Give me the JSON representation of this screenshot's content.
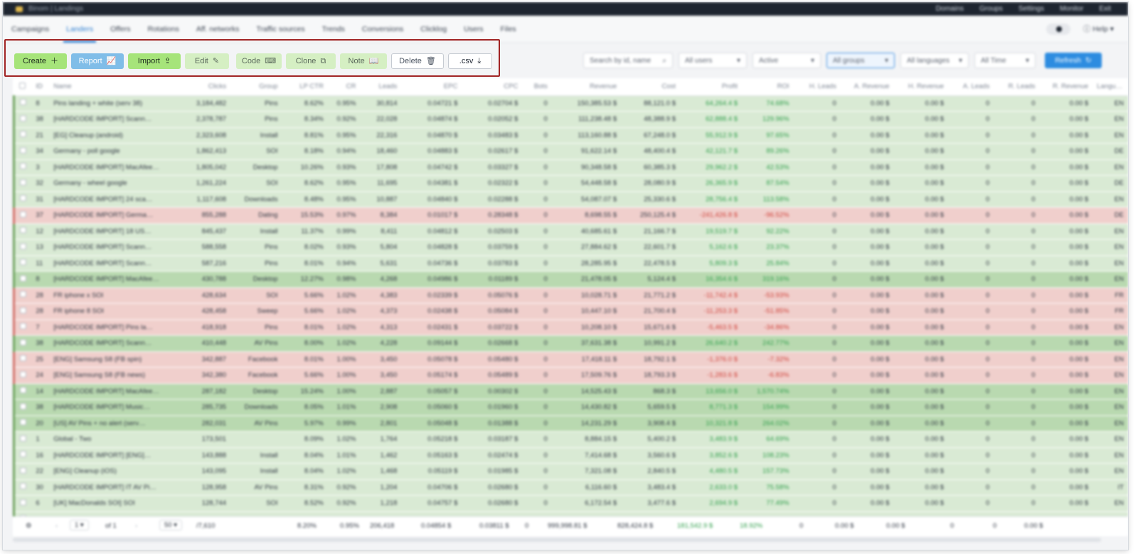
{
  "topbar": {
    "app_title": "Binom | Landings",
    "links": [
      "Domains",
      "Groups",
      "Settings",
      "Monitor",
      "Exit"
    ]
  },
  "nav": {
    "items": [
      "Campaigns",
      "Landers",
      "Offers",
      "Rotations",
      "Aff. networks",
      "Traffic sources",
      "Trends",
      "Conversions",
      "Clicklog",
      "Users",
      "Files"
    ],
    "active": "Landers",
    "help_label": "Help"
  },
  "toolbar": {
    "create": "Create",
    "report": "Report",
    "import": "Import",
    "edit": "Edit",
    "code": "Code",
    "clone": "Clone",
    "note": "Note",
    "delete": "Delete",
    "csv": ".csv",
    "search_placeholder": "Search by id, name",
    "users_filter": "All users",
    "status_filter": "Active",
    "groups_filter": "All groups",
    "languages_filter": "All languages",
    "time_filter": "All Time",
    "refresh": "Refresh"
  },
  "table": {
    "headers": [
      "ID",
      "Name",
      "Clicks",
      "Group",
      "LP CTR",
      "CR",
      "Leads",
      "EPC",
      "CPC",
      "Bots",
      "Revenue",
      "Cost",
      "Profit",
      "ROI",
      "H. Leads",
      "A. Revenue",
      "H. Revenue",
      "A. Leads",
      "R. Leads",
      "R. Revenue",
      "Language"
    ],
    "rows": [
      {
        "tone": "good",
        "id": "8",
        "name": "Pins landing + white (serv 38)",
        "clicks": "3,184,482",
        "group": "Pins",
        "lpctr": "8.62%",
        "cr": "0.95%",
        "leads": "30,814",
        "epc": "0.04721 $",
        "cpc": "0.02704 $",
        "bots": "0",
        "revenue": "150,385.53 $",
        "cost": "88,121.0 $",
        "profit": "64,264.4 $",
        "roi": "74.68%",
        "lang": "EN"
      },
      {
        "tone": "good",
        "id": "38",
        "name": "[HARDCODE IMPORT] Scann…",
        "clicks": "2,378,787",
        "group": "Pins",
        "lpctr": "8.34%",
        "cr": "0.92%",
        "leads": "22,028",
        "epc": "0.04874 $",
        "cpc": "0.02052 $",
        "bots": "0",
        "revenue": "111,238.48 $",
        "cost": "48,388.9 $",
        "profit": "62,888.4 $",
        "roi": "129.96%",
        "lang": "EN"
      },
      {
        "tone": "good",
        "id": "21",
        "name": "[EG] Cleanup (android)",
        "clicks": "2,323,608",
        "group": "Install",
        "lpctr": "8.81%",
        "cr": "0.95%",
        "leads": "22,316",
        "epc": "0.04870 $",
        "cpc": "0.03483 $",
        "bots": "0",
        "revenue": "113,160.88 $",
        "cost": "67,248.0 $",
        "profit": "55,912.9 $",
        "roi": "97.65%",
        "lang": "EN"
      },
      {
        "tone": "good",
        "id": "34",
        "name": "Germany - poll google",
        "clicks": "1,862,413",
        "group": "SOI",
        "lpctr": "8.18%",
        "cr": "0.94%",
        "leads": "18,460",
        "epc": "0.04883 $",
        "cpc": "0.02617 $",
        "bots": "0",
        "revenue": "91,622.14 $",
        "cost": "48,400.4 $",
        "profit": "42,121.7 $",
        "roi": "89.26%",
        "lang": "DE"
      },
      {
        "tone": "good",
        "id": "3",
        "name": "[HARDCODE IMPORT] MacAfee…",
        "clicks": "1,805,042",
        "group": "Desktop",
        "lpctr": "10.26%",
        "cr": "0.93%",
        "leads": "17,808",
        "epc": "0.04742 $",
        "cpc": "0.03327 $",
        "bots": "0",
        "revenue": "90,348.58 $",
        "cost": "60,385.3 $",
        "profit": "29,962.2 $",
        "roi": "42.53%",
        "lang": "EN"
      },
      {
        "tone": "good",
        "id": "32",
        "name": "Germany - wheel google",
        "clicks": "1,261,224",
        "group": "SOI",
        "lpctr": "8.62%",
        "cr": "0.95%",
        "leads": "11,695",
        "epc": "0.04381 $",
        "cpc": "0.02322 $",
        "bots": "0",
        "revenue": "54,448.58 $",
        "cost": "28,080.9 $",
        "profit": "26,365.9 $",
        "roi": "87.54%",
        "lang": "DE"
      },
      {
        "tone": "good",
        "id": "31",
        "name": "[HARDCODE IMPORT] 24 sca…",
        "clicks": "1,117,608",
        "group": "Downloads",
        "lpctr": "8.48%",
        "cr": "0.95%",
        "leads": "10,887",
        "epc": "0.04840 $",
        "cpc": "0.02288 $",
        "bots": "0",
        "revenue": "54,087.07 $",
        "cost": "25,330.6 $",
        "profit": "28,756.4 $",
        "roi": "113.58%",
        "lang": "EN"
      },
      {
        "tone": "bad",
        "id": "37",
        "name": "[HARDCODE IMPORT] Germa…",
        "clicks": "855,288",
        "group": "Dating",
        "lpctr": "15.53%",
        "cr": "0.97%",
        "leads": "8,384",
        "epc": "0.01017 $",
        "cpc": "0.28348 $",
        "bots": "0",
        "revenue": "8,698.55 $",
        "cost": "250,125.4 $",
        "profit": "-241,426.8 $",
        "roi": "-96.52%",
        "lang": "DE"
      },
      {
        "tone": "good",
        "id": "12",
        "name": "[HARDCODE IMPORT] 18 US…",
        "clicks": "845,437",
        "group": "Install",
        "lpctr": "11.37%",
        "cr": "0.99%",
        "leads": "8,411",
        "epc": "0.04812 $",
        "cpc": "0.02503 $",
        "bots": "0",
        "revenue": "40,685.61 $",
        "cost": "21,166.7 $",
        "profit": "19,519.7 $",
        "roi": "92.22%",
        "lang": "EN"
      },
      {
        "tone": "good",
        "id": "13",
        "name": "[HARDCODE IMPORT] Scann…",
        "clicks": "588,558",
        "group": "Pins",
        "lpctr": "8.02%",
        "cr": "0.93%",
        "leads": "5,804",
        "epc": "0.04828 $",
        "cpc": "0.03759 $",
        "bots": "0",
        "revenue": "27,884.62 $",
        "cost": "22,601.7 $",
        "profit": "5,162.6 $",
        "roi": "23.37%",
        "lang": "EN"
      },
      {
        "tone": "good",
        "id": "11",
        "name": "[HARDCODE IMPORT] Scann…",
        "clicks": "587,216",
        "group": "Pins",
        "lpctr": "8.01%",
        "cr": "0.94%",
        "leads": "5,631",
        "epc": "0.04736 $",
        "cpc": "0.03783 $",
        "bots": "0",
        "revenue": "28,285.95 $",
        "cost": "22,478.5 $",
        "profit": "5,809.3 $",
        "roi": "25.84%",
        "lang": "EN"
      },
      {
        "tone": "strong",
        "id": "8",
        "name": "[HARDCODE IMPORT] MacAfee…",
        "clicks": "430,788",
        "group": "Desktop",
        "lpctr": "12.27%",
        "cr": "0.98%",
        "leads": "4,268",
        "epc": "0.04986 $",
        "cpc": "0.01189 $",
        "bots": "0",
        "revenue": "21,478.05 $",
        "cost": "5,124.4 $",
        "profit": "16,354.6 $",
        "roi": "319.16%",
        "lang": "EN"
      },
      {
        "tone": "bad",
        "id": "28",
        "name": "FR iphone x SOI",
        "clicks": "428,634",
        "group": "SOI",
        "lpctr": "5.66%",
        "cr": "1.02%",
        "leads": "4,383",
        "epc": "0.02339 $",
        "cpc": "0.05076 $",
        "bots": "0",
        "revenue": "10,028.71 $",
        "cost": "21,771.2 $",
        "profit": "-11,742.4 $",
        "roi": "-53.93%",
        "lang": "FR"
      },
      {
        "tone": "bad",
        "id": "28",
        "name": "FR iphone 8 SOI",
        "clicks": "428,458",
        "group": "Sweep",
        "lpctr": "5.66%",
        "cr": "1.02%",
        "leads": "4,373",
        "epc": "0.02438 $",
        "cpc": "0.05084 $",
        "bots": "0",
        "revenue": "10,447.10 $",
        "cost": "21,700.4 $",
        "profit": "-11,253.3 $",
        "roi": "-51.85%",
        "lang": "FR"
      },
      {
        "tone": "bad",
        "id": "7",
        "name": "[HARDCODE IMPORT] Pins la…",
        "clicks": "418,918",
        "group": "Pins",
        "lpctr": "8.01%",
        "cr": "1.02%",
        "leads": "4,313",
        "epc": "0.02431 $",
        "cpc": "0.03722 $",
        "bots": "0",
        "revenue": "10,208.10 $",
        "cost": "15,671.6 $",
        "profit": "-5,463.5 $",
        "roi": "-34.86%",
        "lang": "EN"
      },
      {
        "tone": "strong",
        "id": "38",
        "name": "[HARDCODE IMPORT] Scann…",
        "clicks": "410,448",
        "group": "AV Pins",
        "lpctr": "8.00%",
        "cr": "1.02%",
        "leads": "4,228",
        "epc": "0.09144 $",
        "cpc": "0.02668 $",
        "bots": "0",
        "revenue": "37,631.38 $",
        "cost": "10,991.2 $",
        "profit": "26,640.2 $",
        "roi": "242.77%",
        "lang": "EN"
      },
      {
        "tone": "bad",
        "id": "25",
        "name": "[ENG] Samsung S8 (FB spin)",
        "clicks": "342,887",
        "group": "Facebook",
        "lpctr": "8.01%",
        "cr": "1.00%",
        "leads": "3,450",
        "epc": "0.05078 $",
        "cpc": "0.05480 $",
        "bots": "0",
        "revenue": "17,418.11 $",
        "cost": "18,792.1 $",
        "profit": "-1,376.0 $",
        "roi": "-7.32%",
        "lang": "EN"
      },
      {
        "tone": "bad",
        "id": "24",
        "name": "[ENG] Samsung S8 (FB news)",
        "clicks": "342,380",
        "group": "Facebook",
        "lpctr": "5.66%",
        "cr": "1.00%",
        "leads": "3,450",
        "epc": "0.05174 $",
        "cpc": "0.05489 $",
        "bots": "0",
        "revenue": "17,509.76 $",
        "cost": "18,793.3 $",
        "profit": "-1,283.6 $",
        "roi": "-6.83%",
        "lang": "EN"
      },
      {
        "tone": "strong",
        "id": "14",
        "name": "[HARDCODE IMPORT] MacAfee…",
        "clicks": "287,182",
        "group": "Desktop",
        "lpctr": "15.24%",
        "cr": "1.00%",
        "leads": "2,887",
        "epc": "0.05057 $",
        "cpc": "0.00302 $",
        "bots": "0",
        "revenue": "14,525.43 $",
        "cost": "868.3 $",
        "profit": "13,656.0 $",
        "roi": "1,570.74%",
        "lang": "EN"
      },
      {
        "tone": "strong",
        "id": "38",
        "name": "[HARDCODE IMPORT] Music…",
        "clicks": "285,735",
        "group": "Downloads",
        "lpctr": "8.05%",
        "cr": "1.01%",
        "leads": "2,908",
        "epc": "0.05060 $",
        "cpc": "0.01960 $",
        "bots": "0",
        "revenue": "14,430.82 $",
        "cost": "5,659.5 $",
        "profit": "8,771.3 $",
        "roi": "154.99%",
        "lang": "EN"
      },
      {
        "tone": "strong",
        "id": "20",
        "name": "[US] AV Pins + no alert (serv…",
        "clicks": "282,031",
        "group": "AV Pins",
        "lpctr": "5.97%",
        "cr": "0.99%",
        "leads": "2,801",
        "epc": "0.05048 $",
        "cpc": "0.01388 $",
        "bots": "0",
        "revenue": "14,231.29 $",
        "cost": "3,908.4 $",
        "profit": "10,321.8 $",
        "roi": "264.02%",
        "lang": "EN"
      },
      {
        "tone": "good",
        "id": "1",
        "name": "Global - Two",
        "clicks": "173,501",
        "group": "",
        "lpctr": "8.09%",
        "cr": "1.02%",
        "leads": "1,764",
        "epc": "0.05218 $",
        "cpc": "0.03187 $",
        "bots": "0",
        "revenue": "8,884.15 $",
        "cost": "5,400.2 $",
        "profit": "3,483.9 $",
        "roi": "64.69%",
        "lang": "EN"
      },
      {
        "tone": "good",
        "id": "16",
        "name": "[HARDCODE IMPORT] [ENG]…",
        "clicks": "143,888",
        "group": "Install",
        "lpctr": "8.04%",
        "cr": "1.01%",
        "leads": "1,462",
        "epc": "0.05163 $",
        "cpc": "0.02474 $",
        "bots": "0",
        "revenue": "7,414.68 $",
        "cost": "3,560.6 $",
        "profit": "3,852.6 $",
        "roi": "108.23%",
        "lang": "EN"
      },
      {
        "tone": "good",
        "id": "22",
        "name": "[ENG] Cleanup (iOS)",
        "clicks": "143,095",
        "group": "Install",
        "lpctr": "8.04%",
        "cr": "1.02%",
        "leads": "1,468",
        "epc": "0.05119 $",
        "cpc": "0.01985 $",
        "bots": "0",
        "revenue": "7,321.08 $",
        "cost": "2,840.5 $",
        "profit": "4,480.5 $",
        "roi": "157.73%",
        "lang": "EN"
      },
      {
        "tone": "good",
        "id": "30",
        "name": "[HARDCODE IMPORT] IT AV Pi…",
        "clicks": "128,958",
        "group": "AV Pins",
        "lpctr": "8.31%",
        "cr": "0.92%",
        "leads": "1,204",
        "epc": "0.04706 $",
        "cpc": "0.02680 $",
        "bots": "0",
        "revenue": "6,116.60 $",
        "cost": "3,483.4 $",
        "profit": "2,633.0 $",
        "roi": "75.58%",
        "lang": "IT"
      },
      {
        "tone": "good",
        "id": "6",
        "name": "[UK] MacDonalds SOI] SOI",
        "clicks": "128,744",
        "group": "SOI",
        "lpctr": "8.52%",
        "cr": "0.92%",
        "leads": "1,218",
        "epc": "0.04757 $",
        "cpc": "0.02680 $",
        "bots": "0",
        "revenue": "6,172.54 $",
        "cost": "3,477.6 $",
        "profit": "2,694.9 $",
        "roi": "77.49%",
        "lang": "EN"
      },
      {
        "tone": "good",
        "id": "35",
        "name": "[HARDCODE IMPORT] [US] C…",
        "clicks": "126,725",
        "group": "Install",
        "lpctr": "8.34%",
        "cr": "0.93%",
        "leads": "1,213",
        "epc": "0.04720 $",
        "cpc": "0.02680 $",
        "bots": "0",
        "revenue": "6,123.78 $",
        "cost": "3,477.1 $",
        "profit": "2,646.6 $",
        "roi": "76.11%",
        "lang": "EN"
      }
    ],
    "zero_leads": "0",
    "zero_money": "0.00 $"
  },
  "footer": {
    "page": "1",
    "of_pages": "of 1",
    "per_page": "50",
    "count": "/7,610",
    "lpctr": "8.20%",
    "cr": "0.95%",
    "leads": "206,418",
    "epc": "0.04854 $",
    "cpc": "0.03811 $",
    "bots": "0",
    "revenue": "999,998.81 $",
    "cost": "828,424.8 $",
    "profit": "181,542.9 $",
    "roi": "18.92%"
  },
  "colors": {
    "accent": "#2f7fd1",
    "positive": "#2e9e4a",
    "negative": "#d0423a",
    "highlight": "#a12424"
  }
}
